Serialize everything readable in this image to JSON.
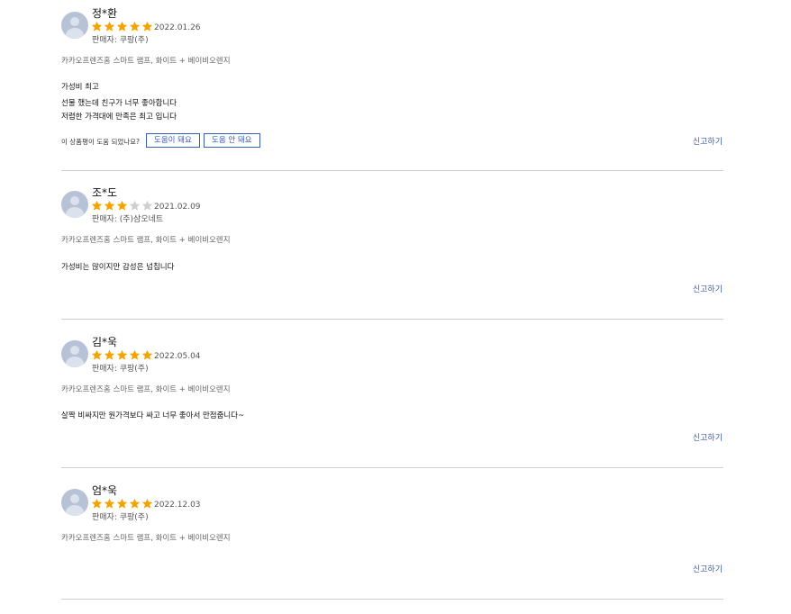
{
  "helpful_question": "이 상품평이 도움 되었나요?",
  "helpful_yes_label": "도움이 돼요",
  "helpful_no_label": "도움 안 돼요",
  "report_label": "신고하기",
  "star_filled_color": "#f5a300",
  "star_empty_color": "#cfcfcf",
  "reviews": [
    {
      "name": "정*환",
      "rating": 5,
      "date": "2022.01.26",
      "seller": "판매자: 쿠팡(주)",
      "product": "카카오프렌즈홈 스마트 램프, 화이트 + 베이비오렌지",
      "content": [
        "가성비 최고",
        "선물 했는데 친구가 너무 좋아합니다",
        "저렴한 가격대에 만족은 최고 입니다"
      ]
    },
    {
      "name": "조*도",
      "rating": 3,
      "date": "2021.02.09",
      "seller": "판매자: (주)삼오네트",
      "product": "카카오프렌즈홈 스마트 램프, 화이트 + 베이비오렌지",
      "content": [
        "가성비는 많이지만 감성은 넘칩니다"
      ]
    },
    {
      "name": "김*욱",
      "rating": 5,
      "date": "2022.05.04",
      "seller": "판매자: 쿠팡(주)",
      "product": "카카오프렌즈홈 스마트 램프, 화이트 + 베이비오렌지",
      "content": [
        "살짝 비싸지만 원가격보다 싸고 너무 좋아서 만점줍니다~"
      ]
    },
    {
      "name": "엄*욱",
      "rating": 5,
      "date": "2022.12.03",
      "seller": "판매자: 쿠팡(주)",
      "product": "카카오프렌즈홈 스마트 램프, 화이트 + 베이비오렌지",
      "content": []
    }
  ]
}
